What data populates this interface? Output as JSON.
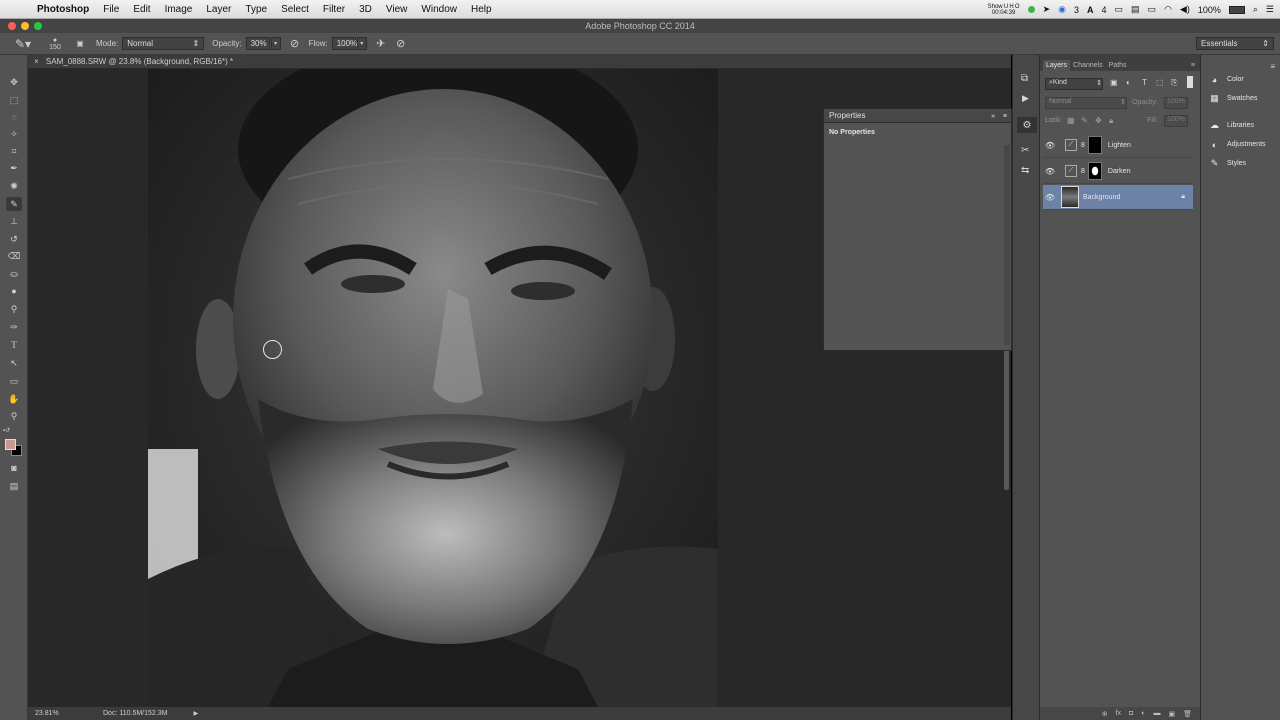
{
  "menubar": {
    "app": "Photoshop",
    "menus": [
      "File",
      "Edit",
      "Image",
      "Layer",
      "Type",
      "Select",
      "Filter",
      "3D",
      "View",
      "Window",
      "Help"
    ],
    "status": {
      "clock_line1": "Show U H O",
      "clock_line2": "00:04:39",
      "badge_a": "3",
      "badge_b": "4",
      "battery": "100%"
    }
  },
  "window": {
    "title": "Adobe Photoshop CC 2014"
  },
  "options_bar": {
    "brush_size": "150",
    "mode_label": "Mode:",
    "mode_value": "Normal",
    "opacity_label": "Opacity:",
    "opacity_value": "30%",
    "flow_label": "Flow:",
    "flow_value": "100%",
    "workspace": "Essentials"
  },
  "document": {
    "tab_title": "SAM_0888.SRW @ 23.8% (Background, RGB/16*) *",
    "zoom": "23.81%",
    "doc_size": "Doc: 110.5M/152.3M"
  },
  "properties": {
    "title": "Properties",
    "content": "No Properties"
  },
  "layers_panel": {
    "tabs": [
      "Layers",
      "Channels",
      "Paths"
    ],
    "filter": "Kind",
    "blend_mode": "Normal",
    "opacity_label": "Opacity:",
    "opacity_value": "100%",
    "lock_label": "Lock:",
    "fill_label": "Fill:",
    "fill_value": "100%",
    "layers": [
      {
        "name": "Lighten"
      },
      {
        "name": "Darken"
      },
      {
        "name": "Background"
      }
    ]
  },
  "library_panel": {
    "items": [
      "Color",
      "Swatches",
      "Libraries",
      "Adjustments",
      "Styles"
    ]
  },
  "colors": {
    "foreground": "#c99a92",
    "background": "#000000",
    "selection": "#6c82a6"
  }
}
